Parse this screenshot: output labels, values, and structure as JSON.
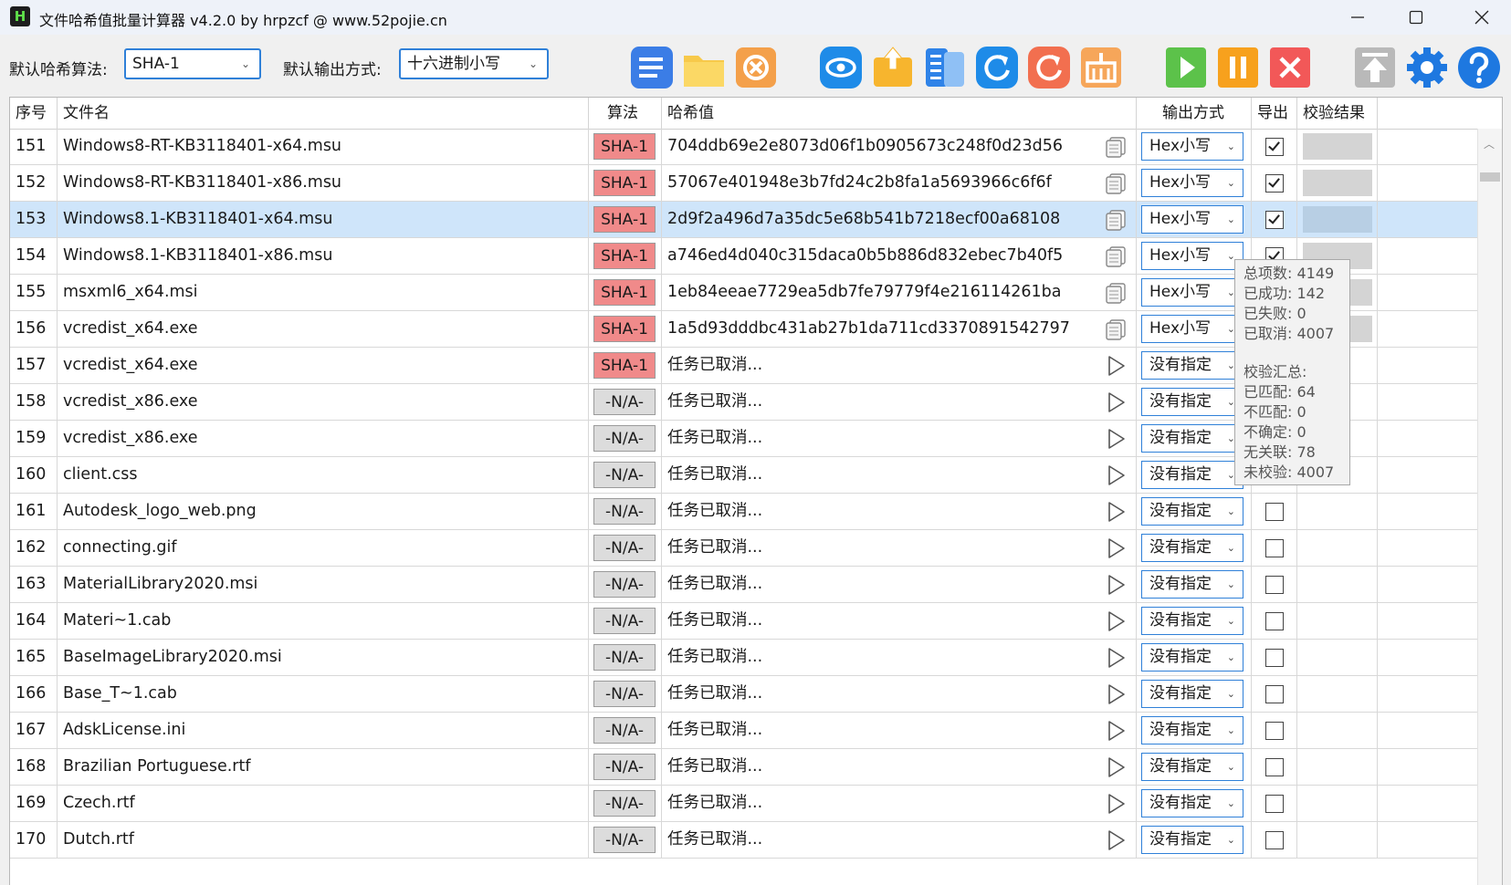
{
  "window": {
    "logo_letter": "H",
    "title": "文件哈希值批量计算器 v4.2.0 by hrpzcf @ www.52pojie.cn"
  },
  "toolbar": {
    "algo_label": "默认哈希算法:",
    "algo_value": "SHA-1",
    "output_label": "默认输出方式:",
    "output_value": "十六进制小写"
  },
  "icons": {
    "toolbar": [
      "list-icon",
      "folder-icon",
      "clear-icon",
      "eye-icon",
      "export-icon",
      "columns-icon",
      "refresh-icon",
      "reset-icon",
      "clean-icon",
      "start-icon",
      "pause-icon",
      "stop-icon",
      "top-icon",
      "settings-icon",
      "help-icon"
    ]
  },
  "colors": {
    "accent": "#2f80d8",
    "sha_badge": "#f08a8a",
    "na_badge": "#dcdcdc",
    "selected_row": "#cfe5fa"
  },
  "table": {
    "headers": {
      "index": "序号",
      "filename": "文件名",
      "algo": "算法",
      "hash": "哈希值",
      "output": "输出方式",
      "export": "导出",
      "verify": "校验结果"
    },
    "rows": [
      {
        "index": "151",
        "filename": "Windows8-RT-KB3118401-x64.msu",
        "algo": "SHA-1",
        "hash": "704ddb69e2e8073d06f1b0905673c248f0d23d56",
        "output": "Hex小写",
        "checked": true,
        "done": true
      },
      {
        "index": "152",
        "filename": "Windows8-RT-KB3118401-x86.msu",
        "algo": "SHA-1",
        "hash": "57067e401948e3b7fd24c2b8fa1a5693966c6f6f",
        "output": "Hex小写",
        "checked": true,
        "done": true
      },
      {
        "index": "153",
        "filename": "Windows8.1-KB3118401-x64.msu",
        "algo": "SHA-1",
        "hash": "2d9f2a496d7a35dc5e68b541b7218ecf00a68108",
        "output": "Hex小写",
        "checked": true,
        "done": true,
        "selected": true
      },
      {
        "index": "154",
        "filename": "Windows8.1-KB3118401-x86.msu",
        "algo": "SHA-1",
        "hash": "a746ed4d040c315daca0b5b886d832ebec7b40f5",
        "output": "Hex小写",
        "checked": true,
        "done": true
      },
      {
        "index": "155",
        "filename": "msxml6_x64.msi",
        "algo": "SHA-1",
        "hash": "1eb84eeae7729ea5db7fe79779f4e216114261ba",
        "output": "Hex小写",
        "checked": true,
        "done": true
      },
      {
        "index": "156",
        "filename": "vcredist_x64.exe",
        "algo": "SHA-1",
        "hash": "1a5d93dddbc431ab27b1da711cd3370891542797",
        "output": "Hex小写",
        "checked": true,
        "done": true
      },
      {
        "index": "157",
        "filename": "vcredist_x64.exe",
        "algo": "SHA-1",
        "hash": "任务已取消...",
        "output": "没有指定",
        "checked": false,
        "done": false
      },
      {
        "index": "158",
        "filename": "vcredist_x86.exe",
        "algo": "-N/A-",
        "hash": "任务已取消...",
        "output": "没有指定",
        "checked": false,
        "done": false
      },
      {
        "index": "159",
        "filename": "vcredist_x86.exe",
        "algo": "-N/A-",
        "hash": "任务已取消...",
        "output": "没有指定",
        "checked": false,
        "done": false
      },
      {
        "index": "160",
        "filename": "client.css",
        "algo": "-N/A-",
        "hash": "任务已取消...",
        "output": "没有指定",
        "checked": false,
        "done": false
      },
      {
        "index": "161",
        "filename": "Autodesk_logo_web.png",
        "algo": "-N/A-",
        "hash": "任务已取消...",
        "output": "没有指定",
        "checked": false,
        "done": false
      },
      {
        "index": "162",
        "filename": "connecting.gif",
        "algo": "-N/A-",
        "hash": "任务已取消...",
        "output": "没有指定",
        "checked": false,
        "done": false
      },
      {
        "index": "163",
        "filename": "MaterialLibrary2020.msi",
        "algo": "-N/A-",
        "hash": "任务已取消...",
        "output": "没有指定",
        "checked": false,
        "done": false
      },
      {
        "index": "164",
        "filename": "Materi~1.cab",
        "algo": "-N/A-",
        "hash": "任务已取消...",
        "output": "没有指定",
        "checked": false,
        "done": false
      },
      {
        "index": "165",
        "filename": "BaseImageLibrary2020.msi",
        "algo": "-N/A-",
        "hash": "任务已取消...",
        "output": "没有指定",
        "checked": false,
        "done": false
      },
      {
        "index": "166",
        "filename": "Base_T~1.cab",
        "algo": "-N/A-",
        "hash": "任务已取消...",
        "output": "没有指定",
        "checked": false,
        "done": false
      },
      {
        "index": "167",
        "filename": "AdskLicense.ini",
        "algo": "-N/A-",
        "hash": "任务已取消...",
        "output": "没有指定",
        "checked": false,
        "done": false
      },
      {
        "index": "168",
        "filename": "Brazilian Portuguese.rtf",
        "algo": "-N/A-",
        "hash": "任务已取消...",
        "output": "没有指定",
        "checked": false,
        "done": false
      },
      {
        "index": "169",
        "filename": "Czech.rtf",
        "algo": "-N/A-",
        "hash": "任务已取消...",
        "output": "没有指定",
        "checked": false,
        "done": false
      },
      {
        "index": "170",
        "filename": "Dutch.rtf",
        "algo": "-N/A-",
        "hash": "任务已取消...",
        "output": "没有指定",
        "checked": false,
        "done": false
      }
    ]
  },
  "tooltip": {
    "total": "总项数: 4149",
    "success": "已成功: 142",
    "failed": "已失败: 0",
    "cancelled": "已取消: 4007",
    "verify_title": "校验汇总:",
    "matched": "已匹配: 64",
    "mismatched": "不匹配: 0",
    "uncertain": "不确定: 0",
    "unrelated": "无关联: 78",
    "unverified": "未校验: 4007"
  }
}
